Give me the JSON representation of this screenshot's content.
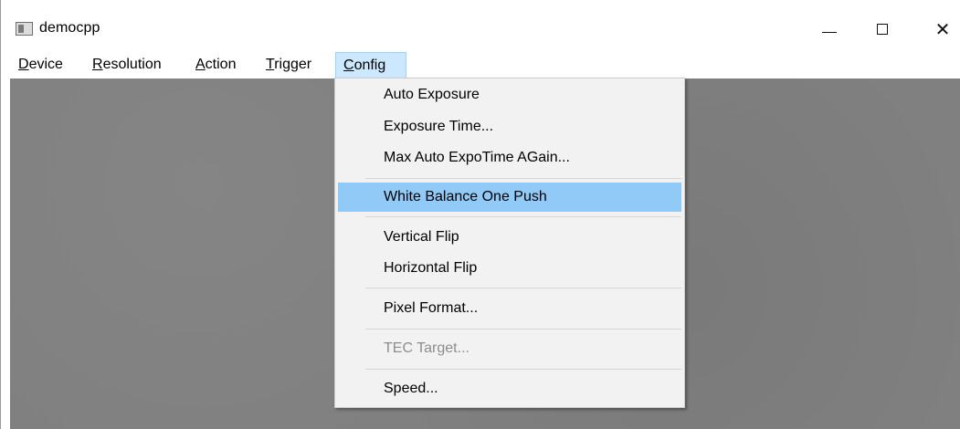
{
  "window": {
    "title": "democpp",
    "icon": "app-window-icon",
    "controls": {
      "minimize": "minimize-icon",
      "maximize": "maximize-icon",
      "close": "close-icon"
    }
  },
  "menubar": {
    "items": [
      {
        "label": "Device",
        "mnemonic": "D"
      },
      {
        "label": "Resolution",
        "mnemonic": "R"
      },
      {
        "label": "Action",
        "mnemonic": "A"
      },
      {
        "label": "Trigger",
        "mnemonic": "T"
      },
      {
        "label": "Config",
        "mnemonic": "C"
      }
    ]
  },
  "config_menu": {
    "items": [
      {
        "label": "Auto Exposure",
        "state": "enabled"
      },
      {
        "label": "Exposure Time...",
        "state": "enabled"
      },
      {
        "label": "Max Auto ExpoTime AGain...",
        "state": "enabled"
      },
      {
        "label": "White Balance One Push",
        "state": "highlighted"
      },
      {
        "label": "Vertical Flip",
        "state": "enabled"
      },
      {
        "label": "Horizontal Flip",
        "state": "enabled"
      },
      {
        "label": "Pixel Format...",
        "state": "enabled"
      },
      {
        "label": "TEC Target...",
        "state": "disabled"
      },
      {
        "label": "Speed...",
        "state": "enabled"
      }
    ]
  },
  "colors": {
    "content_background": "#808080",
    "menu_background": "#f2f2f2",
    "menu_highlight": "#91c9f7",
    "menubar_active": "#cce8ff",
    "disabled_text": "#8d8d8d"
  }
}
